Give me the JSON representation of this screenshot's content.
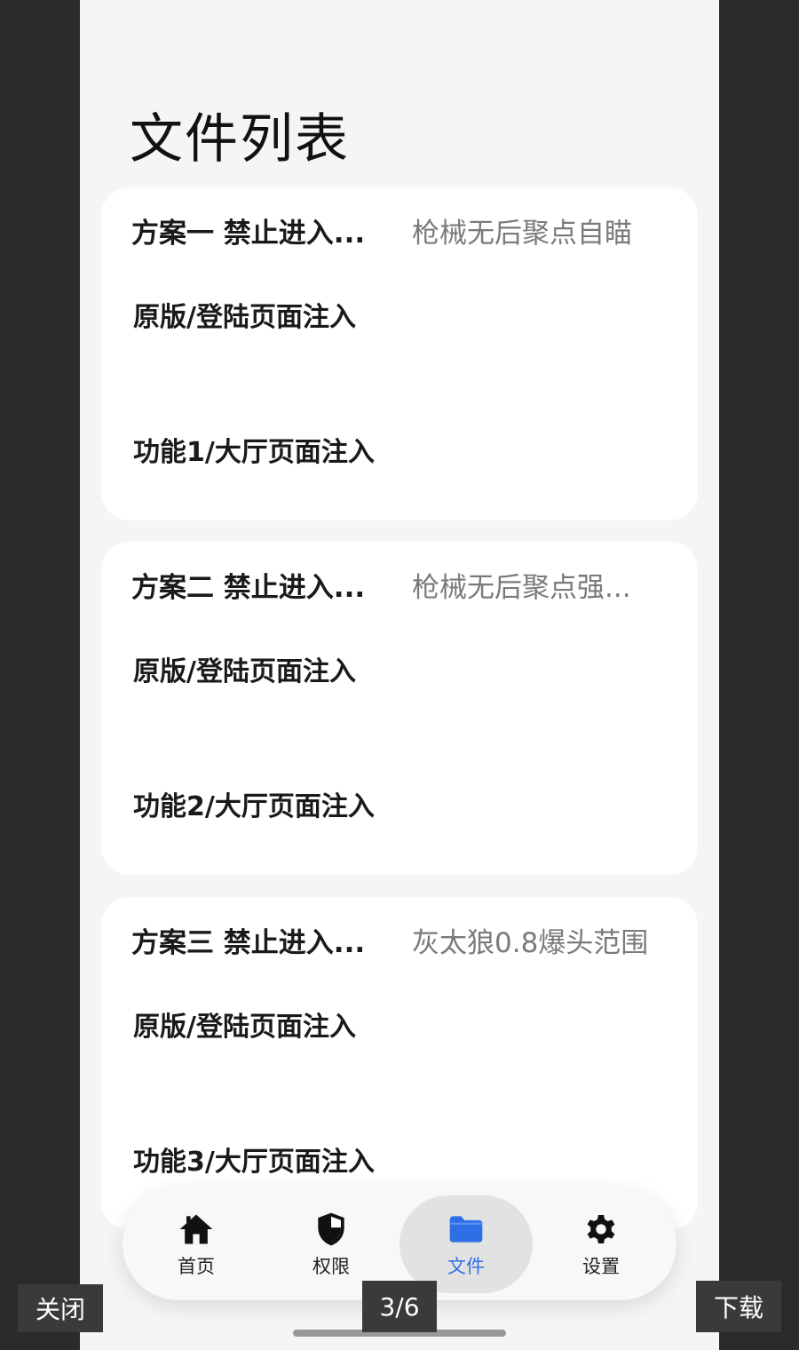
{
  "page": {
    "title": "文件列表"
  },
  "cards": [
    {
      "title": "方案一 禁止进入...",
      "subtitle": "枪械无后聚点自瞄",
      "item1": "原版/登陆页面注入",
      "item2": "功能1/大厅页面注入"
    },
    {
      "title": "方案二 禁止进入...",
      "subtitle": "枪械无后聚点强...",
      "item1": "原版/登陆页面注入",
      "item2": "功能2/大厅页面注入"
    },
    {
      "title": "方案三 禁止进入...",
      "subtitle": "灰太狼0.8爆头范围",
      "item1": "原版/登陆页面注入",
      "item2": "功能3/大厅页面注入"
    }
  ],
  "nav": {
    "items": [
      {
        "label": "首页",
        "icon": "home-icon"
      },
      {
        "label": "权限",
        "icon": "shield-icon"
      },
      {
        "label": "文件",
        "icon": "folder-icon",
        "active": true
      },
      {
        "label": "设置",
        "icon": "gear-icon"
      }
    ],
    "active_color": "#2e6fe6"
  },
  "viewer": {
    "close_label": "关闭",
    "page_indicator": "3/6",
    "download_label": "下载"
  }
}
